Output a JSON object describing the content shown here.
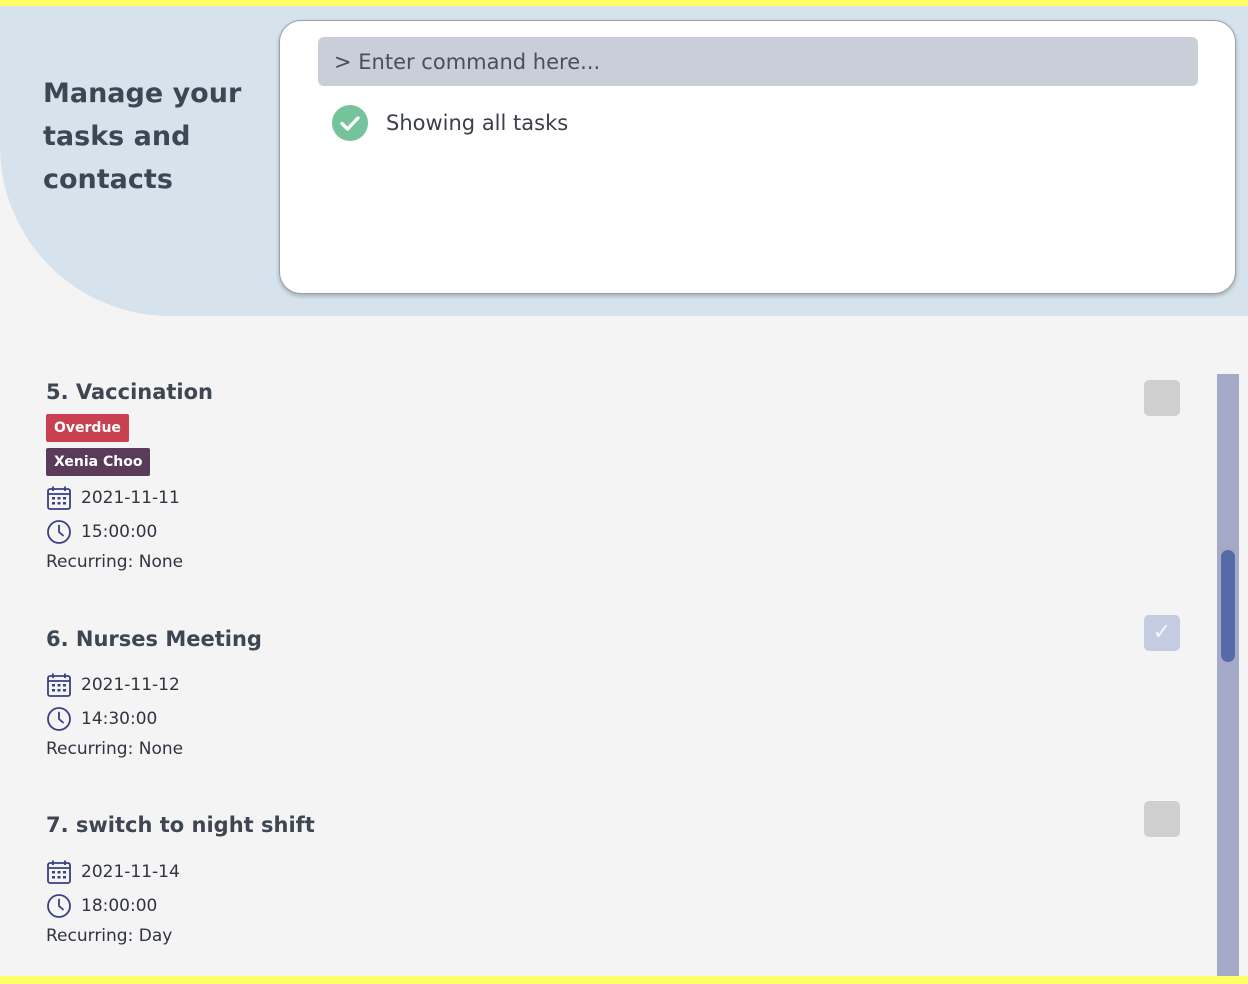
{
  "header": {
    "tagline": "Manage your tasks and contacts",
    "command_placeholder": "> Enter command here...",
    "result_message": "Showing all tasks"
  },
  "colors": {
    "header_band": "#d6e3ec",
    "success": "#74c39b",
    "overdue_tag": "#c94050",
    "contact_tag": "#5a3c5a",
    "scroll_thumb": "#566aa8"
  },
  "icons": {
    "date": "calendar-icon",
    "time": "clock-icon",
    "result": "check-circle-icon"
  },
  "tasks": [
    {
      "title": "5. Vaccination",
      "tags": {
        "overdue": "Overdue",
        "contact": "Xenia Choo"
      },
      "date": "2021-11-11",
      "time": "15:00:00",
      "recurring": "Recurring: None",
      "done": false
    },
    {
      "title": "6. Nurses Meeting",
      "date": "2021-11-12",
      "time": "14:30:00",
      "recurring": "Recurring: None",
      "done": true,
      "check_glyph": "✓"
    },
    {
      "title": "7. switch to night shift",
      "date": "2021-11-14",
      "time": "18:00:00",
      "recurring": "Recurring: Day",
      "done": false
    }
  ]
}
